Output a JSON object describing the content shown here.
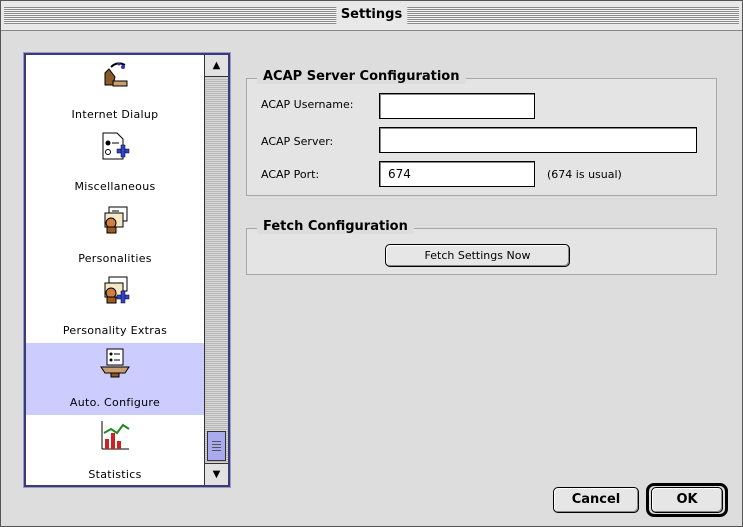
{
  "window": {
    "title": "Settings"
  },
  "sidebar": {
    "items": [
      {
        "label": "Internet Dialup",
        "icon": "phone-dialup-icon"
      },
      {
        "label": "Miscellaneous",
        "icon": "document-plus-icon"
      },
      {
        "label": "Personalities",
        "icon": "envelope-person-icon"
      },
      {
        "label": "Personality Extras",
        "icon": "envelope-person-plus-icon"
      },
      {
        "label": "Auto. Configure",
        "icon": "auto-configure-icon",
        "selected": true
      },
      {
        "label": "Statistics",
        "icon": "chart-icon"
      }
    ]
  },
  "acap": {
    "title": "ACAP Server Configuration",
    "username_label": "ACAP Username:",
    "username_value": "",
    "server_label": "ACAP Server:",
    "server_value": "",
    "port_label": "ACAP Port:",
    "port_value": "674",
    "port_hint": "(674 is usual)"
  },
  "fetch": {
    "title": "Fetch Configuration",
    "button_label": "Fetch Settings Now"
  },
  "footer": {
    "cancel_label": "Cancel",
    "ok_label": "OK"
  },
  "colors": {
    "selection": "#ccccff",
    "sidebar_border": "#3b3b77",
    "window_bg": "#dddddd"
  }
}
